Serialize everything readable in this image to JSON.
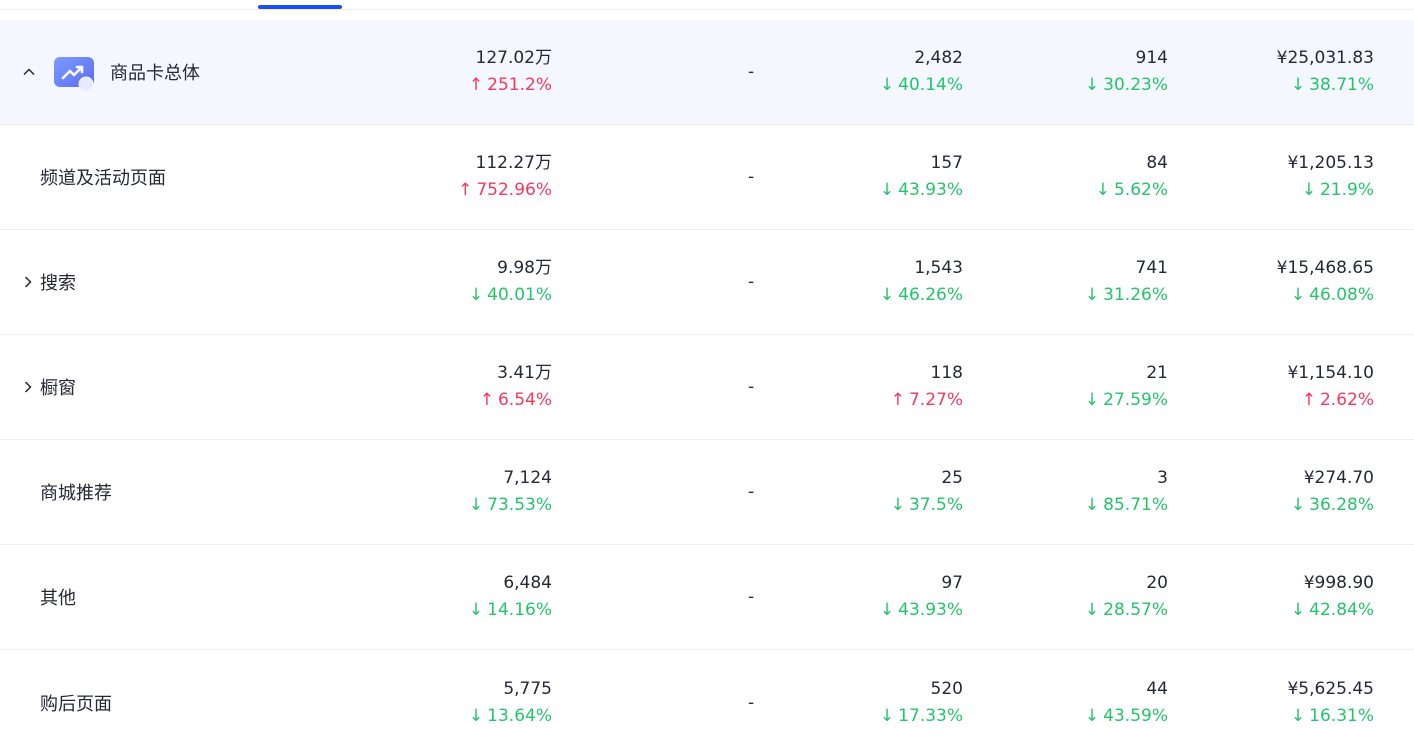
{
  "colors": {
    "up": "#f5385e",
    "down": "#23c46a",
    "accent": "#1d4ff0",
    "summary_bg": "#f4f7fe"
  },
  "icons": {
    "expanded": "chevron-up-icon",
    "collapsed": "chevron-right-icon",
    "summary": "trend-chart-icon"
  },
  "rows": [
    {
      "name": "商品卡总体",
      "m1": {
        "value": "127.02万",
        "change": "251.2%",
        "dir": "up"
      },
      "m2": "-",
      "m3": {
        "value": "2,482",
        "change": "40.14%",
        "dir": "down"
      },
      "m4": {
        "value": "914",
        "change": "30.23%",
        "dir": "down"
      },
      "m5": {
        "value": "¥25,031.83",
        "change": "38.71%",
        "dir": "down"
      }
    },
    {
      "name": "频道及活动页面",
      "m1": {
        "value": "112.27万",
        "change": "752.96%",
        "dir": "up"
      },
      "m2": "-",
      "m3": {
        "value": "157",
        "change": "43.93%",
        "dir": "down"
      },
      "m4": {
        "value": "84",
        "change": "5.62%",
        "dir": "down"
      },
      "m5": {
        "value": "¥1,205.13",
        "change": "21.9%",
        "dir": "down"
      }
    },
    {
      "name": "搜索",
      "m1": {
        "value": "9.98万",
        "change": "40.01%",
        "dir": "down"
      },
      "m2": "-",
      "m3": {
        "value": "1,543",
        "change": "46.26%",
        "dir": "down"
      },
      "m4": {
        "value": "741",
        "change": "31.26%",
        "dir": "down"
      },
      "m5": {
        "value": "¥15,468.65",
        "change": "46.08%",
        "dir": "down"
      }
    },
    {
      "name": "橱窗",
      "m1": {
        "value": "3.41万",
        "change": "6.54%",
        "dir": "up"
      },
      "m2": "-",
      "m3": {
        "value": "118",
        "change": "7.27%",
        "dir": "up"
      },
      "m4": {
        "value": "21",
        "change": "27.59%",
        "dir": "down"
      },
      "m5": {
        "value": "¥1,154.10",
        "change": "2.62%",
        "dir": "up"
      }
    },
    {
      "name": "商城推荐",
      "m1": {
        "value": "7,124",
        "change": "73.53%",
        "dir": "down"
      },
      "m2": "-",
      "m3": {
        "value": "25",
        "change": "37.5%",
        "dir": "down"
      },
      "m4": {
        "value": "3",
        "change": "85.71%",
        "dir": "down"
      },
      "m5": {
        "value": "¥274.70",
        "change": "36.28%",
        "dir": "down"
      }
    },
    {
      "name": "其他",
      "m1": {
        "value": "6,484",
        "change": "14.16%",
        "dir": "down"
      },
      "m2": "-",
      "m3": {
        "value": "97",
        "change": "43.93%",
        "dir": "down"
      },
      "m4": {
        "value": "20",
        "change": "28.57%",
        "dir": "down"
      },
      "m5": {
        "value": "¥998.90",
        "change": "42.84%",
        "dir": "down"
      }
    },
    {
      "name": "购后页面",
      "m1": {
        "value": "5,775",
        "change": "13.64%",
        "dir": "down"
      },
      "m2": "-",
      "m3": {
        "value": "520",
        "change": "17.33%",
        "dir": "down"
      },
      "m4": {
        "value": "44",
        "change": "43.59%",
        "dir": "down"
      },
      "m5": {
        "value": "¥5,625.45",
        "change": "16.31%",
        "dir": "down"
      }
    }
  ]
}
